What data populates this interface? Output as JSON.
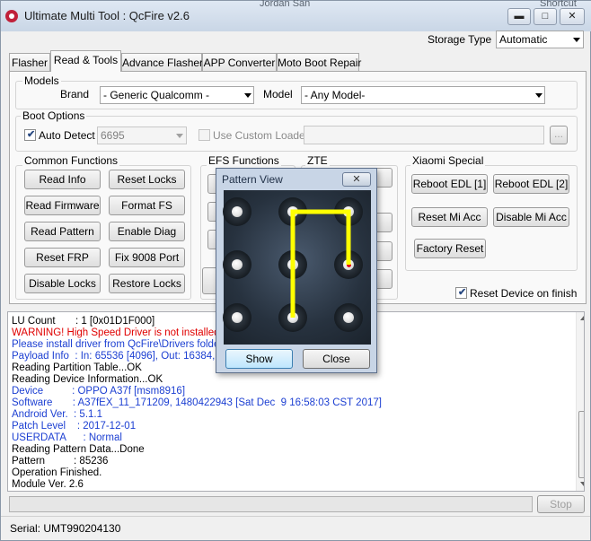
{
  "window": {
    "title": "Ultimate Multi Tool : QcFire v2.6",
    "background_titles": [
      "Jordan San",
      "Shortcut"
    ],
    "controls": {
      "minimize": "▬",
      "maximize": "□",
      "close": "✕"
    }
  },
  "storage": {
    "label": "Storage Type",
    "value": "Automatic"
  },
  "tabs": [
    "Flasher",
    "Read & Tools",
    "Advance Flasher",
    "APP Converter",
    "Moto Boot Repair"
  ],
  "active_tab": 1,
  "models": {
    "legend": "Models",
    "brand_label": "Brand",
    "brand_value": "- Generic Qualcomm -",
    "model_label": "Model",
    "model_value": "- Any Model-"
  },
  "boot": {
    "legend": "Boot Options",
    "auto_detect_label": "Auto Detect",
    "auto_detect_checked": true,
    "port_value": "6695",
    "custom_loader_label": "Use Custom Loader",
    "custom_loader_checked": false,
    "browse_label": "..."
  },
  "common": {
    "legend": "Common Functions",
    "buttons": [
      "Read Info",
      "Reset Locks",
      "Read Firmware",
      "Format FS",
      "Read Pattern",
      "Enable Diag",
      "Reset FRP",
      "Fix 9008 Port",
      "Disable Locks",
      "Restore Locks"
    ]
  },
  "efs": {
    "legend": "EFS Functions"
  },
  "zte": {
    "legend": "ZTE"
  },
  "xiaomi": {
    "legend": "Xiaomi Special",
    "buttons": [
      "Reboot EDL [1]",
      "Reboot EDL [2]",
      "Reset Mi Acc",
      "Disable Mi Acc",
      "Factory Reset"
    ]
  },
  "reset_on_finish": {
    "label": "Reset Device on finish",
    "checked": true
  },
  "log": [
    {
      "text": "LU Count       : 1 [0x01D1F000]",
      "color": "#000000"
    },
    {
      "text": "WARNING! High Speed Driver is not installed.",
      "color": "#e00000"
    },
    {
      "text": "Please install driver from QcFire\\Drivers folder u",
      "color": "#1c3fd2"
    },
    {
      "text": "Payload Info  : In: 65536 [4096], Out: 16384, S",
      "color": "#1c3fd2"
    },
    {
      "text": "Reading Partition Table...OK",
      "color": "#000000"
    },
    {
      "text": "Reading Device Information...OK",
      "color": "#000000"
    },
    {
      "text": "Device          : OPPO A37f [msm8916]",
      "color": "#1c3fd2"
    },
    {
      "text": "Software       : A37fEX_11_171209, 1480422943 [Sat Dec  9 16:58:03 CST 2017]",
      "color": "#1c3fd2"
    },
    {
      "text": "Android Ver.  : 5.1.1",
      "color": "#1c3fd2"
    },
    {
      "text": "Patch Level    : 2017-12-01",
      "color": "#1c3fd2"
    },
    {
      "text": "USERDATA      : Normal",
      "color": "#1c3fd2"
    },
    {
      "text": "Reading Pattern Data...Done",
      "color": "#000000"
    },
    {
      "text": "Pattern          : 85236",
      "color": "#000000"
    },
    {
      "text": "Operation Finished.",
      "color": "#000000"
    },
    {
      "text": "Module Ver. 2.6",
      "color": "#000000"
    }
  ],
  "progress": {
    "value": 0
  },
  "stop_label": "Stop",
  "status": {
    "serial": "Serial: UMT990204130"
  },
  "pattern_dialog": {
    "title": "Pattern View",
    "close_label": "✕",
    "show_label": "Show",
    "close_button_label": "Close",
    "pattern": [
      8,
      5,
      2,
      3,
      6
    ],
    "line_color": "#ffff00",
    "marker_color": "#e01010"
  }
}
